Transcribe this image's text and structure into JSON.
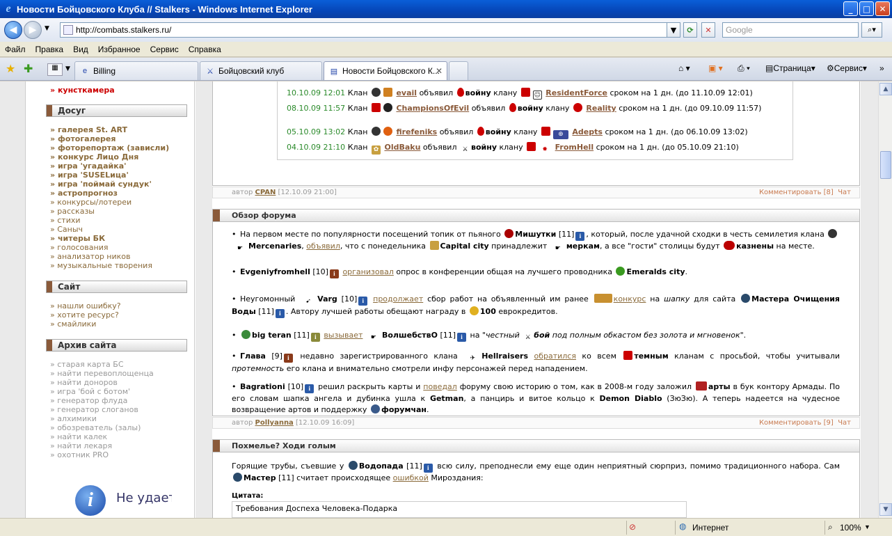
{
  "window": {
    "title": "Новости Бойцовского Клуба // Stalkers - Windows Internet Explorer"
  },
  "address": {
    "url": "http://combats.stalkers.ru/",
    "search_placeholder": "Google"
  },
  "menu": [
    "Файл",
    "Правка",
    "Вид",
    "Избранное",
    "Сервис",
    "Справка"
  ],
  "tabs": [
    {
      "label": "Billing"
    },
    {
      "label": "Бойцовский клуб"
    },
    {
      "label": "Новости Бойцовского К..."
    }
  ],
  "toolbar": {
    "page": "Страница",
    "service": "Сервис"
  },
  "sidebar": {
    "top_item": "кунсткамера",
    "sections": [
      {
        "title": "Досуг",
        "items": [
          "галерея St. ART",
          "фотогалерея",
          "фоторепортаж (зависли)",
          "конкурс Лицо Дня",
          "игра 'угадайка'",
          "игра 'SUSELица'",
          "игра 'поймай сундук'",
          "астропрогноз",
          "конкурсы/лотереи",
          "рассказы",
          "стихи",
          "Саныч",
          "читеры БК",
          "голосования",
          "анализатор ников",
          "музыкальные творения"
        ]
      },
      {
        "title": "Сайт",
        "items": [
          "нашли ошибку?",
          "хотите ресурс?",
          "смайлики"
        ]
      },
      {
        "title": "Архив сайта",
        "items": [
          "старая карта БС",
          "найти перевоплощенца",
          "найти доноров",
          "игра 'бой с ботом'",
          "генератор флуда",
          "генератор слоганов",
          "алхимики",
          "обозреватель (залы)",
          "найти калек",
          "найти лекаря",
          "охотник PRO"
        ]
      }
    ],
    "info_text": "Не удается"
  },
  "wars": [
    {
      "date": "10.10.09 12:01",
      "pre": "Клан",
      "clan1": "evail",
      "mid": "объявил",
      "war": "войну",
      "to": "клану",
      "clan2": "ResidentForce",
      "post": "сроком на 1 дн. (до 11.10.09 12:01)"
    },
    {
      "date": "08.10.09 11:57",
      "pre": "Клан",
      "clan1": "ChampionsOfEvil",
      "mid": "объявил",
      "war": "войну",
      "to": "клану",
      "clan2": "Reality",
      "post": "сроком на 1 дн. (до 09.10.09 11:57)"
    },
    {
      "date": "05.10.09 13:02",
      "pre": "Клан",
      "clan1": "firefeniks",
      "mid": "объявил",
      "war": "войну",
      "to": "клану",
      "clan2": "Adepts",
      "post": "сроком на 1 дн. (до 06.10.09 13:02)"
    },
    {
      "date": "04.10.09 21:10",
      "pre": "Клан",
      "clan1": "OldBaku",
      "mid": "объявил",
      "war": "войну",
      "to": "клану",
      "clan2": "FromHell",
      "post": "сроком на 1 дн. (до 05.10.09 21:10)"
    }
  ],
  "footers": [
    {
      "author_label": "автор",
      "author": "CPAN",
      "date": "[12.10.09 21:00]",
      "comment": "Комментировать [8]",
      "chat": "Чат"
    },
    {
      "author_label": "автор",
      "author": "Pollyanna",
      "date": "[12.10.09 16:09]",
      "comment": "Комментировать [9]",
      "chat": "Чат"
    }
  ],
  "forum": {
    "title": "Обзор форума"
  },
  "hangover": {
    "title": "Похмелье? Ходи голым",
    "quote_label": "Цитата:",
    "quote": "Требования Доспеха Человека-Подарка"
  },
  "status": {
    "zone": "Интернет",
    "zoom": "100%"
  }
}
